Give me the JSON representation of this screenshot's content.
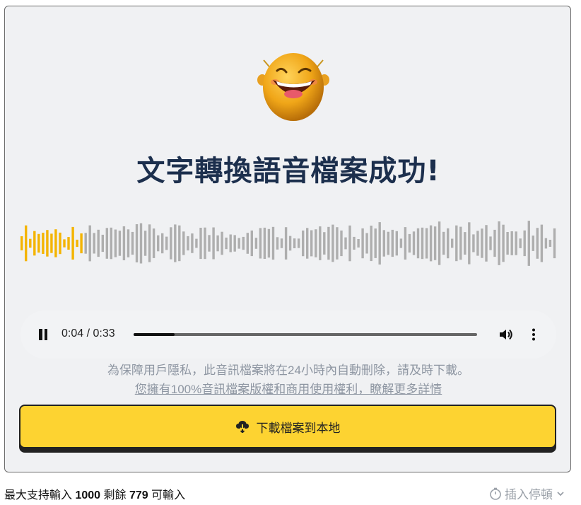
{
  "title": "文字轉換語音檔案成功!",
  "player": {
    "current_time": "0:04",
    "separator": " / ",
    "duration": "0:33",
    "progress": 0.12,
    "played_color": "#f4b400",
    "unplayed_color": "#aeaeae"
  },
  "notice": {
    "privacy": "為保障用戶隱私，此音訊檔案將在24小時內自動刪除，請及時下載。",
    "rights_link": "您擁有100%音訊檔案版權和商用使用權利，瞭解更多詳情"
  },
  "download_button": {
    "label": "下載檔案到本地",
    "icon": "cloud-download-icon",
    "color": "#fdd331"
  },
  "footer": {
    "prefix": "最大支持輸入",
    "max": "1000",
    "remaining_label": "剩餘",
    "remaining": "779",
    "suffix": "可輸入",
    "insert_pause": "插入停頓",
    "insert_pause_icon": "timer-icon"
  },
  "icons": {
    "mascot": "smiley-mascot-icon",
    "pause": "pause-icon",
    "volume": "volume-icon",
    "more": "more-vertical-icon"
  }
}
